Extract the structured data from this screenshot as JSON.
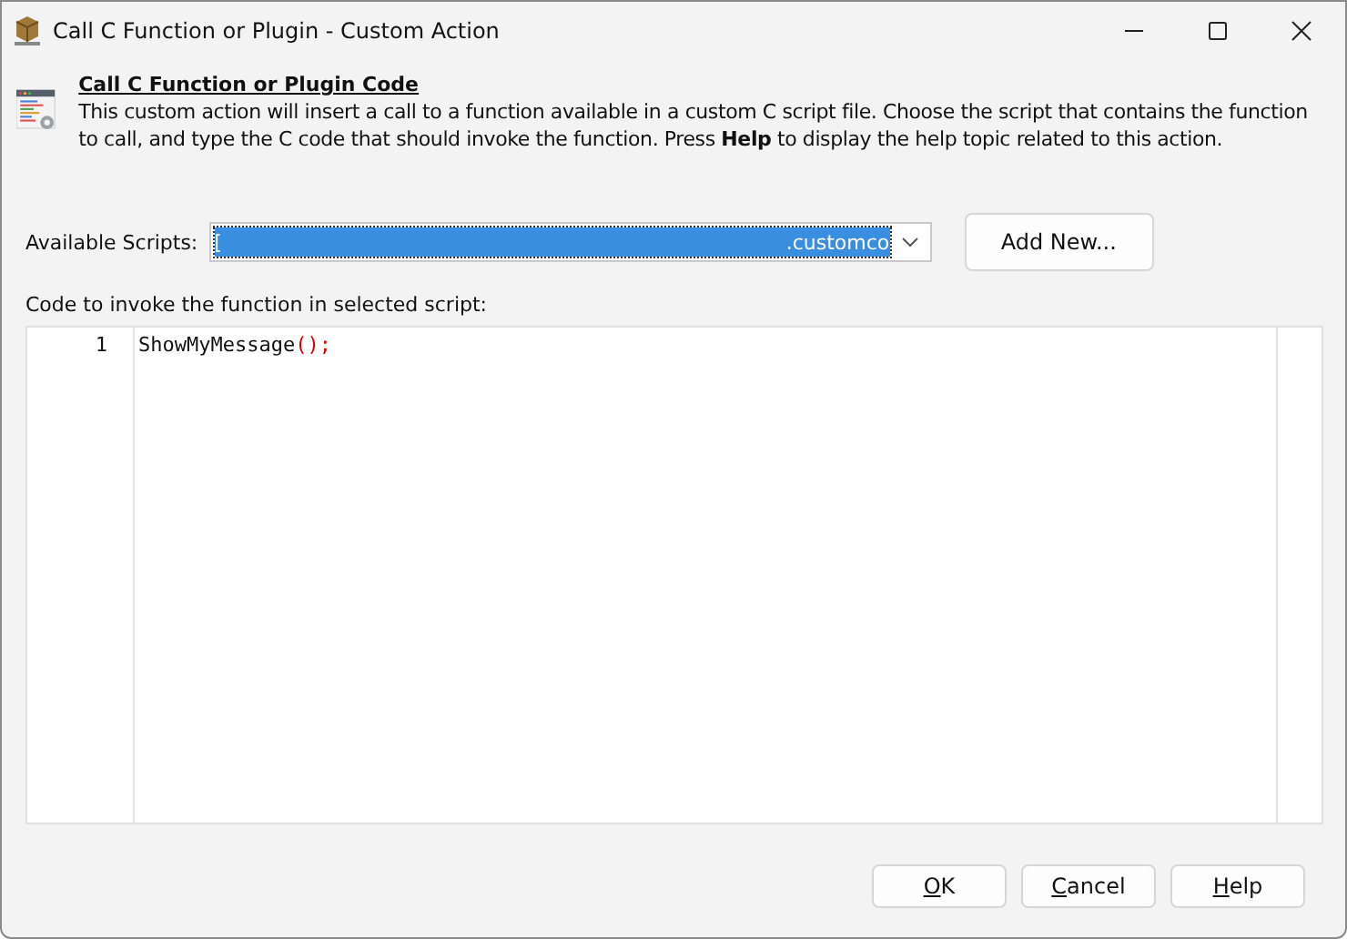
{
  "window": {
    "title": "Call C Function or Plugin - Custom Action"
  },
  "header": {
    "title": "Call C Function or Plugin Code",
    "description": "This custom action will insert a call to a function available in a custom C script file. Choose the script that contains the function to call, and type the C code that should invoke the function. Press **Help** to display the help topic related to this action."
  },
  "scripts": {
    "label": "Available Scripts:",
    "value_start": "[",
    "value_end": ".customco",
    "add_button": "Add New..."
  },
  "code": {
    "label": "Code to invoke the function in selected script:",
    "lines": [
      {
        "number": "1",
        "tokens": [
          {
            "text": "ShowMyMessage",
            "kind": "ident"
          },
          {
            "text": "();",
            "kind": "punct"
          }
        ]
      }
    ]
  },
  "buttons": [
    {
      "label": "OK",
      "underline_first": true
    },
    {
      "label": "Cancel",
      "underline_first": true
    },
    {
      "label": "Help",
      "underline_first": true
    }
  ]
}
